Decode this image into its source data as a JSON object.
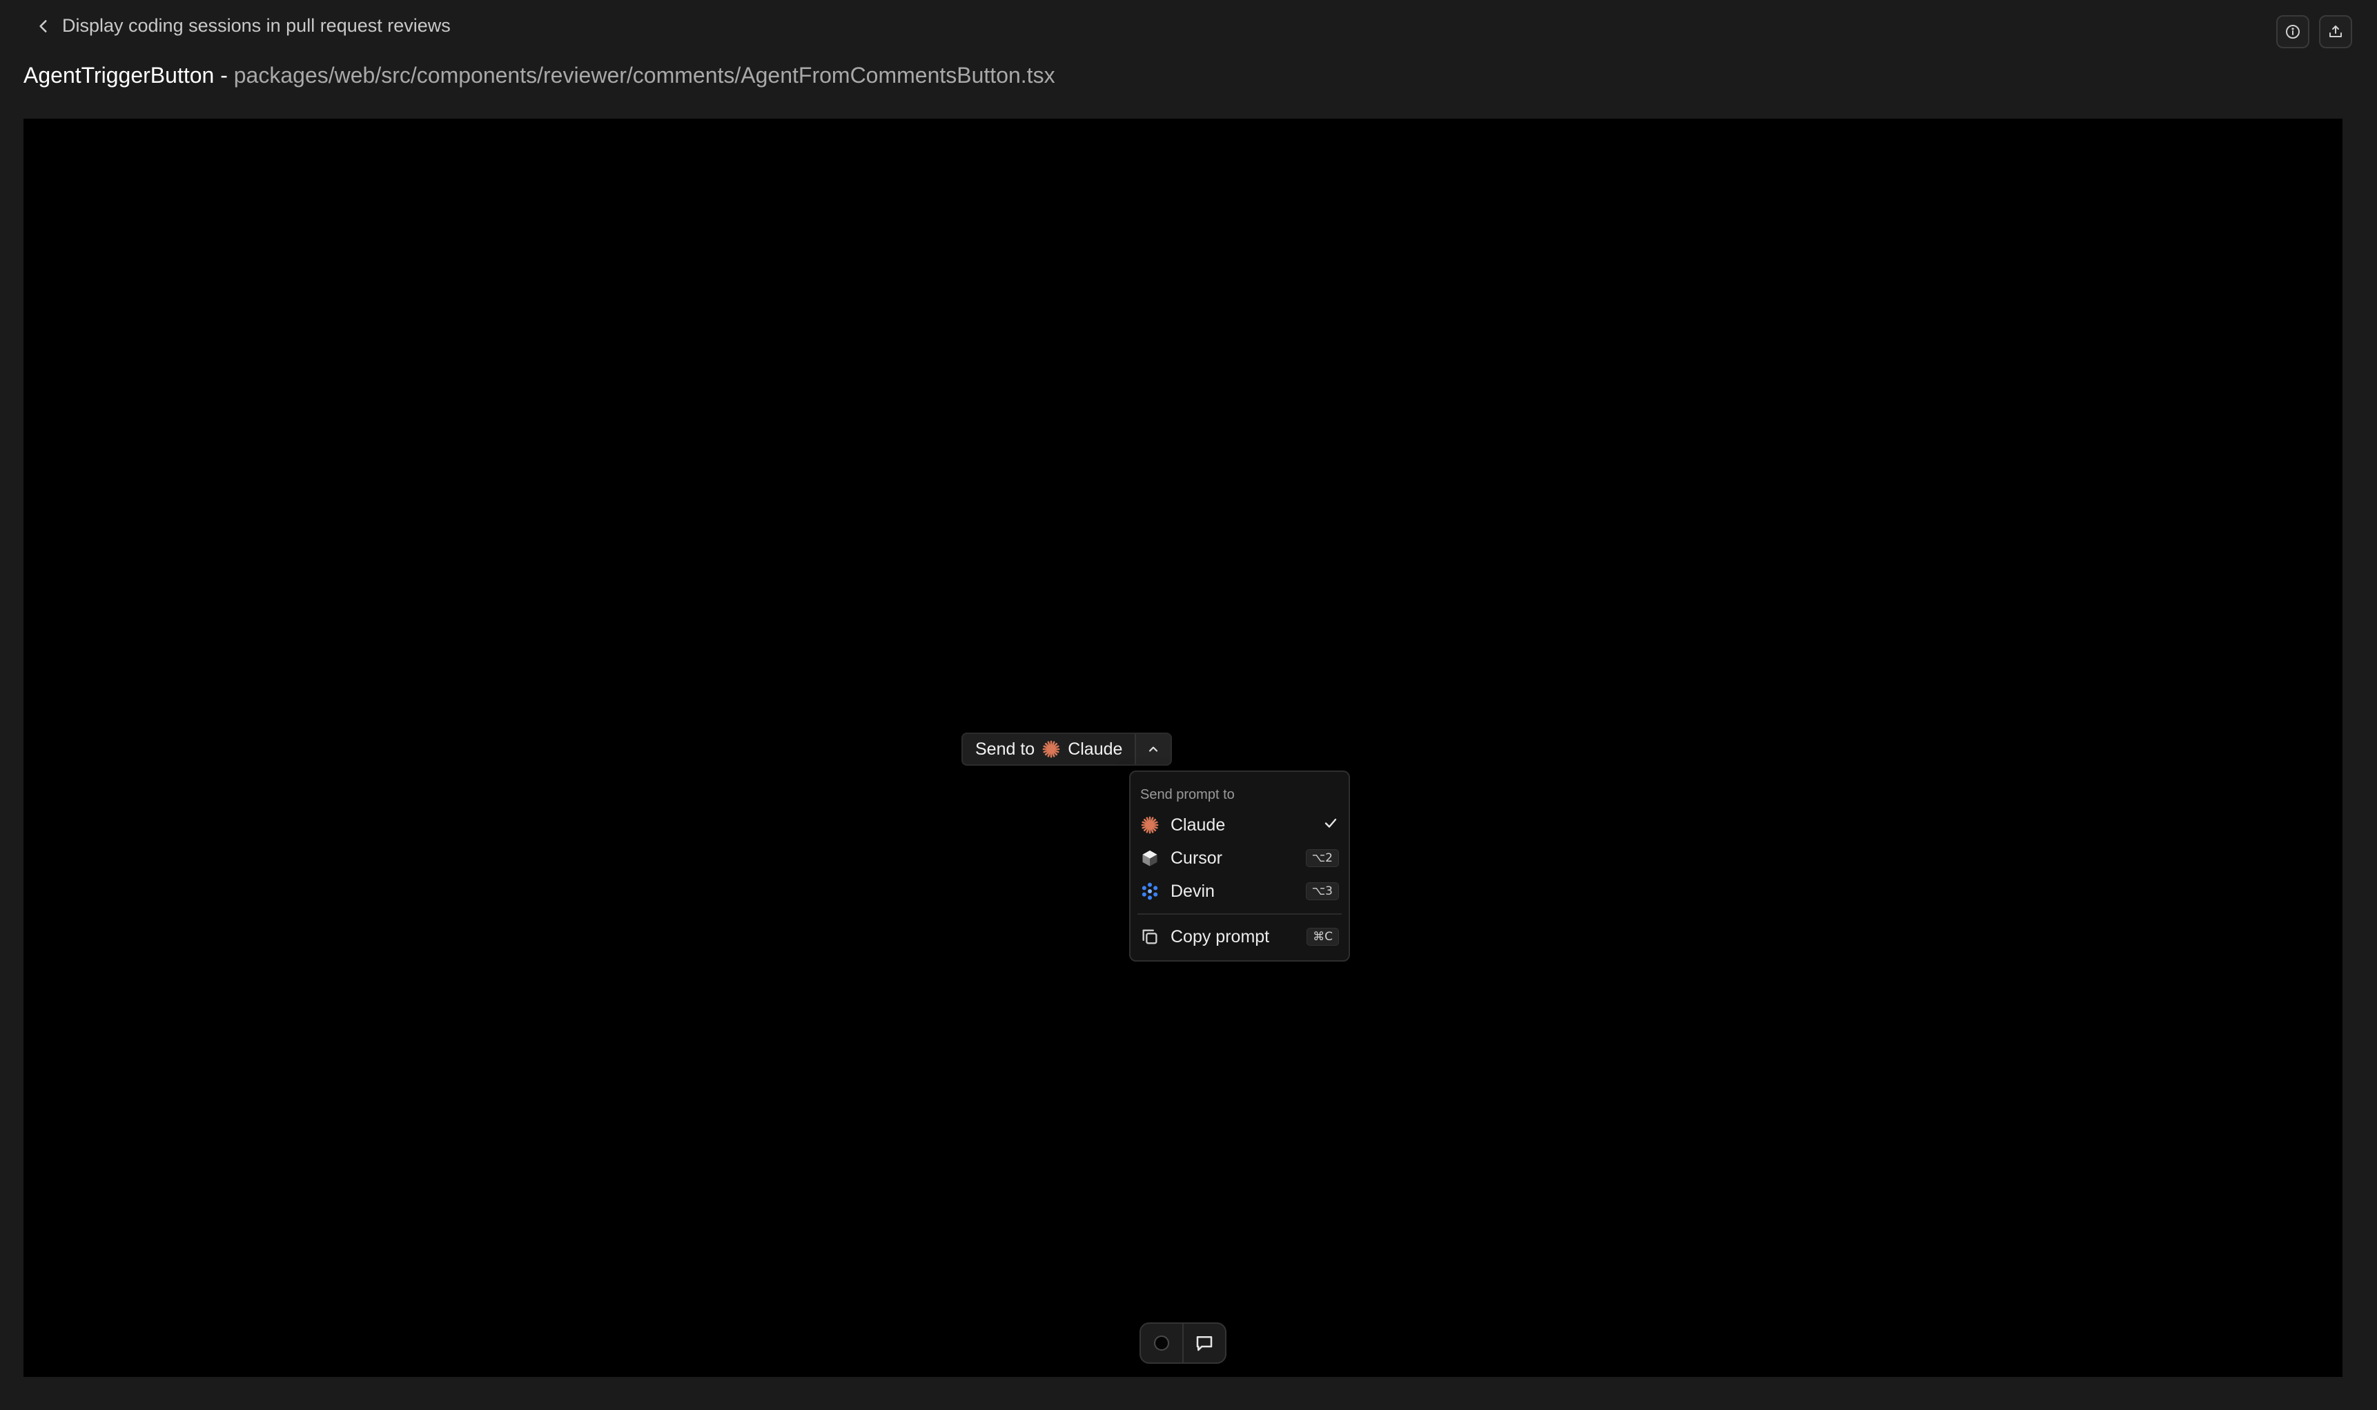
{
  "header": {
    "back_label": "Display coding sessions in pull request reviews",
    "component_name": "AgentTriggerButton",
    "separator": " - ",
    "file_path": "packages/web/src/components/reviewer/comments/AgentFromCommentsButton.tsx"
  },
  "split_button": {
    "prefix": "Send to",
    "agent": "Claude"
  },
  "menu": {
    "heading": "Send prompt to",
    "items": [
      {
        "label": "Claude",
        "icon": "claude-icon",
        "selected": true
      },
      {
        "label": "Cursor",
        "icon": "cursor-icon",
        "shortcut": "⌥2"
      },
      {
        "label": "Devin",
        "icon": "devin-icon",
        "shortcut": "⌥3"
      }
    ],
    "copy": {
      "label": "Copy prompt",
      "icon": "copy-icon",
      "shortcut": "⌘C"
    }
  },
  "colors": {
    "claude_accent": "#d97757",
    "devin_accent": "#3b82f6",
    "background": "#1b1b1b",
    "canvas": "#000000"
  }
}
